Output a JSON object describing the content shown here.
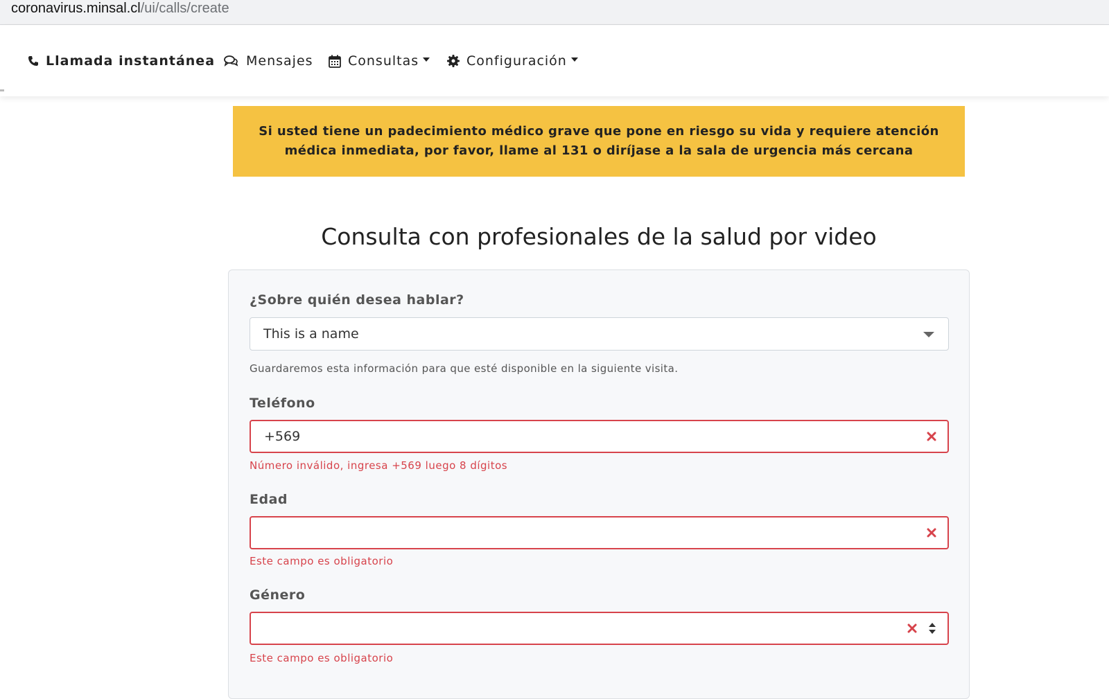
{
  "browser": {
    "url_domain": "coronavirus.minsal.cl",
    "url_path": "/ui/calls/create"
  },
  "navbar": {
    "items": [
      {
        "label": "Llamada instantánea",
        "icon": "phone-icon"
      },
      {
        "label": "Mensajes",
        "icon": "comments-icon"
      },
      {
        "label": "Consultas",
        "icon": "calendar-icon",
        "dropdown": true
      },
      {
        "label": "Configuración",
        "icon": "gear-icon",
        "dropdown": true
      }
    ]
  },
  "alert": {
    "text": "Si usted tiene un padecimiento médico grave que pone en riesgo su vida y requiere atención médica inmediata, por favor, llame al 131 o diríjase a la sala de urgencia más cercana",
    "color": "#f5c242"
  },
  "page_title": "Consulta con profesionales de la salud por video",
  "form": {
    "patient": {
      "label": "¿Sobre quién desea hablar?",
      "value": "This is a name",
      "help": "Guardaremos esta información para que esté disponible en la siguiente visita."
    },
    "phone": {
      "label": "Teléfono",
      "value": "+569",
      "error": "Número inválido, ingresa +569 luego 8 dígitos"
    },
    "age": {
      "label": "Edad",
      "value": "",
      "error": "Este campo es obligatorio"
    },
    "gender": {
      "label": "Género",
      "value": "",
      "error": "Este campo es obligatorio"
    }
  },
  "colors": {
    "error": "#d7434b",
    "alert_bg": "#f5c242",
    "card_bg": "#f7f8fa"
  }
}
